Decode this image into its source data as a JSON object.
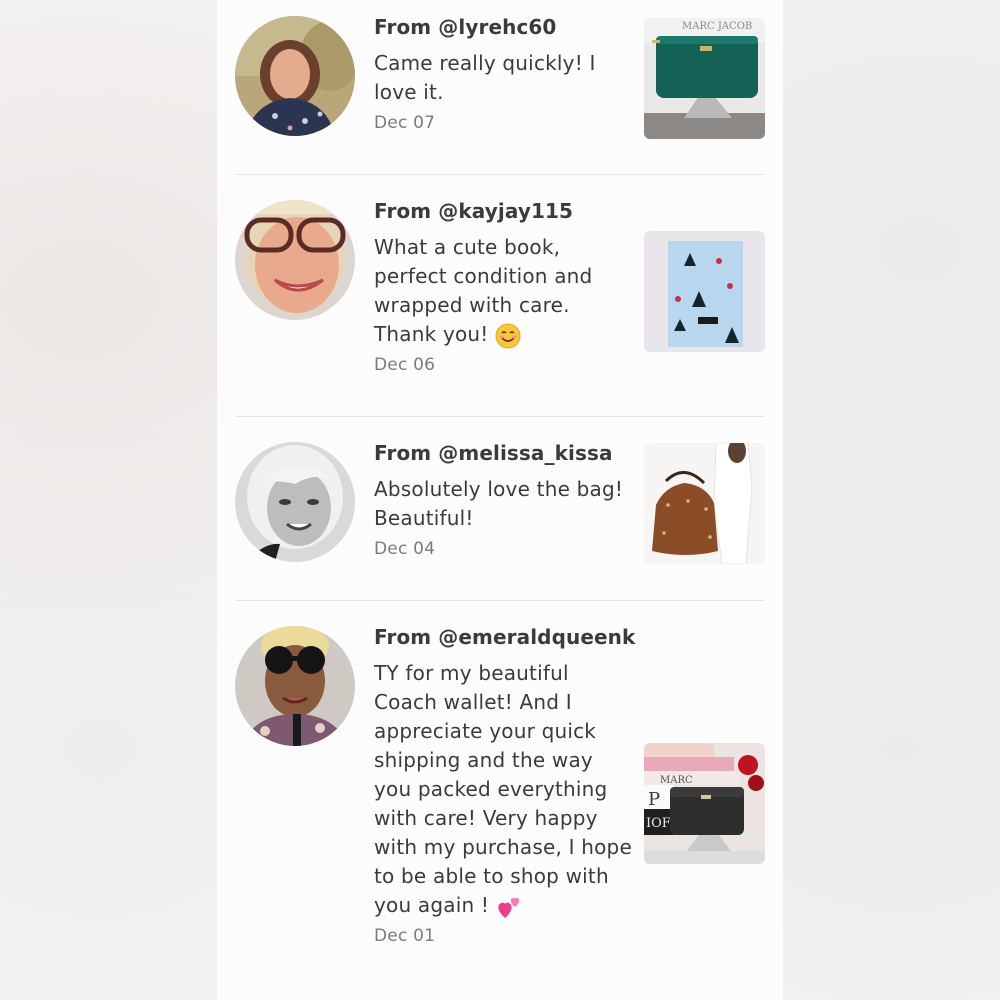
{
  "reviews": [
    {
      "from": "From @lyrehc60",
      "message": "Came really quickly! I love it.",
      "date": "Dec 07",
      "thumb_brand": "MARC JACOB"
    },
    {
      "from": "From @kayjay115",
      "message": "What a cute book, perfect condition and wrapped with care. Thank you!",
      "message_emoji": "smiling-face-emoji",
      "date": "Dec 06"
    },
    {
      "from": "From @melissa_kissa",
      "message": "Absolutely love the bag! Beautiful!",
      "date": "Dec 04"
    },
    {
      "from": "From @emeraldqueenk",
      "message": "TY for my beautiful Coach wallet! And I appreciate your quick shipping and the way you packed everything with care! Very happy with my purchase, I hope to be able to shop with you again !",
      "message_emoji": "two-hearts-emoji",
      "date": "Dec 01",
      "thumb_labels": [
        "MARC",
        "P",
        "IOF"
      ]
    }
  ],
  "colors": {
    "panel_bg": "#fdfcfd",
    "text_primary": "#3b3b3b",
    "text_secondary": "#7b7b7b",
    "divider": "#e6e4e5"
  }
}
